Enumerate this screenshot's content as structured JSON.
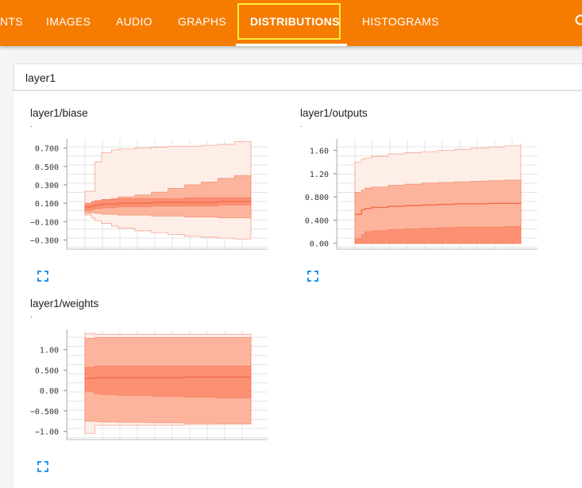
{
  "nav": {
    "tabs": [
      {
        "label": "NTS"
      },
      {
        "label": "IMAGES"
      },
      {
        "label": "AUDIO"
      },
      {
        "label": "GRAPHS"
      },
      {
        "label": "DISTRIBUTIONS"
      },
      {
        "label": "HISTOGRAMS"
      }
    ],
    "active_tab": "DISTRIBUTIONS",
    "search_icon": "search-icon"
  },
  "run": {
    "name": "layer1"
  },
  "colors": {
    "accent": "#f57c00",
    "active_outline": "#ffeb3b",
    "band_light": "#fdeee8",
    "band_mid": "#fcae93",
    "band_dark": "#fb8a6c",
    "line": "#f2704e",
    "expand_icon": "#2196f3"
  },
  "cards": [
    {
      "title": "layer1/biase",
      "subtitle": ".",
      "expand_icon": "fullscreen-icon"
    },
    {
      "title": "layer1/outputs",
      "subtitle": ".",
      "expand_icon": "fullscreen-icon"
    },
    {
      "title": "layer1/weights",
      "subtitle": ".",
      "expand_icon": "fullscreen-icon"
    }
  ],
  "chart_data": [
    {
      "type": "area",
      "title": "layer1/biase",
      "ylim": [
        -0.4,
        0.8
      ],
      "yticks": [
        0.7,
        0.5,
        0.3,
        0.1,
        -0.1,
        -0.3
      ],
      "ytick_labels": [
        "0.700",
        "0.500",
        "0.300",
        "0.100",
        "−0.100",
        "−0.300"
      ],
      "xlim": [
        0,
        50
      ],
      "x": [
        0,
        2,
        3,
        5,
        8,
        10,
        15,
        20,
        25,
        30,
        35,
        40,
        45,
        50
      ],
      "bands": [
        {
          "level": "outer",
          "low": [
            -0.03,
            -0.06,
            -0.09,
            -0.12,
            -0.15,
            -0.17,
            -0.2,
            -0.22,
            -0.24,
            -0.26,
            -0.27,
            -0.28,
            -0.29,
            -0.29
          ],
          "high": [
            0.23,
            0.23,
            0.55,
            0.65,
            0.68,
            0.69,
            0.7,
            0.71,
            0.72,
            0.72,
            0.73,
            0.74,
            0.77,
            0.77
          ]
        },
        {
          "level": "mid",
          "low": [
            -0.01,
            0.0,
            -0.01,
            -0.02,
            -0.02,
            -0.03,
            -0.03,
            -0.04,
            -0.04,
            -0.05,
            -0.05,
            -0.06,
            -0.06,
            -0.06
          ],
          "high": [
            0.08,
            0.1,
            0.12,
            0.14,
            0.15,
            0.17,
            0.19,
            0.22,
            0.26,
            0.3,
            0.33,
            0.37,
            0.4,
            0.4
          ]
        },
        {
          "level": "inner",
          "low": [
            0.02,
            0.03,
            0.04,
            0.05,
            0.05,
            0.06,
            0.06,
            0.07,
            0.07,
            0.07,
            0.07,
            0.08,
            0.08,
            0.08
          ],
          "high": [
            0.1,
            0.12,
            0.13,
            0.14,
            0.14,
            0.15,
            0.15,
            0.15,
            0.15,
            0.16,
            0.16,
            0.16,
            0.16,
            0.16
          ]
        }
      ],
      "median": [
        0.06,
        0.07,
        0.08,
        0.09,
        0.09,
        0.1,
        0.1,
        0.11,
        0.11,
        0.11,
        0.11,
        0.12,
        0.12,
        0.12
      ]
    },
    {
      "type": "area",
      "title": "layer1/outputs",
      "ylim": [
        -0.1,
        1.8
      ],
      "yticks": [
        1.6,
        1.2,
        0.8,
        0.4,
        0.0
      ],
      "ytick_labels": [
        "1.60",
        "1.20",
        "0.800",
        "0.400",
        "0.00"
      ],
      "xlim": [
        0,
        50
      ],
      "x": [
        0,
        2,
        3,
        5,
        10,
        15,
        20,
        25,
        30,
        35,
        40,
        45,
        50
      ],
      "bands": [
        {
          "level": "outer",
          "low": [
            0,
            0,
            0,
            0,
            0,
            0,
            0,
            0,
            0,
            0,
            0,
            0,
            0
          ],
          "high": [
            1.4,
            1.45,
            1.47,
            1.5,
            1.54,
            1.56,
            1.58,
            1.6,
            1.62,
            1.64,
            1.66,
            1.68,
            1.72
          ]
        },
        {
          "level": "mid",
          "low": [
            0,
            0,
            0,
            0,
            0,
            0,
            0,
            0,
            0,
            0,
            0,
            0,
            0
          ],
          "high": [
            0.88,
            0.92,
            0.95,
            0.97,
            1.0,
            1.02,
            1.04,
            1.05,
            1.06,
            1.07,
            1.08,
            1.09,
            1.1
          ]
        },
        {
          "level": "inner",
          "low": [
            0,
            0,
            0,
            0,
            0,
            0,
            0,
            0,
            0,
            0,
            0,
            0,
            0
          ],
          "high": [
            0.08,
            0.15,
            0.2,
            0.22,
            0.24,
            0.25,
            0.26,
            0.27,
            0.28,
            0.28,
            0.28,
            0.29,
            0.29
          ]
        }
      ],
      "median": [
        0.5,
        0.58,
        0.6,
        0.62,
        0.64,
        0.65,
        0.66,
        0.67,
        0.68,
        0.68,
        0.69,
        0.69,
        0.7
      ]
    },
    {
      "type": "area",
      "title": "layer1/weights",
      "ylim": [
        -1.2,
        1.5
      ],
      "yticks": [
        1.0,
        0.5,
        0.0,
        -0.5,
        -1.0
      ],
      "ytick_labels": [
        "1.00",
        "0.500",
        "0.00",
        "−0.500",
        "−1.00"
      ],
      "xlim": [
        0,
        50
      ],
      "x": [
        0,
        2,
        3,
        5,
        10,
        20,
        30,
        40,
        50
      ],
      "bands": [
        {
          "level": "outer",
          "low": [
            -1.05,
            -1.05,
            -0.85,
            -0.85,
            -0.85,
            -0.85,
            -0.83,
            -0.82,
            -0.82
          ],
          "high": [
            1.4,
            1.4,
            1.38,
            1.38,
            1.38,
            1.38,
            1.38,
            1.38,
            1.38
          ]
        },
        {
          "level": "mid",
          "low": [
            -0.75,
            -0.75,
            -0.76,
            -0.77,
            -0.78,
            -0.79,
            -0.8,
            -0.8,
            -0.8
          ],
          "high": [
            1.28,
            1.28,
            1.3,
            1.3,
            1.3,
            1.3,
            1.3,
            1.3,
            1.3
          ]
        },
        {
          "level": "inner",
          "low": [
            -0.02,
            -0.04,
            -0.08,
            -0.1,
            -0.12,
            -0.14,
            -0.16,
            -0.18,
            -0.2
          ],
          "high": [
            0.57,
            0.57,
            0.6,
            0.6,
            0.6,
            0.6,
            0.6,
            0.6,
            0.6
          ]
        }
      ],
      "median": [
        0.3,
        0.3,
        0.32,
        0.32,
        0.32,
        0.32,
        0.33,
        0.33,
        0.33
      ]
    }
  ]
}
